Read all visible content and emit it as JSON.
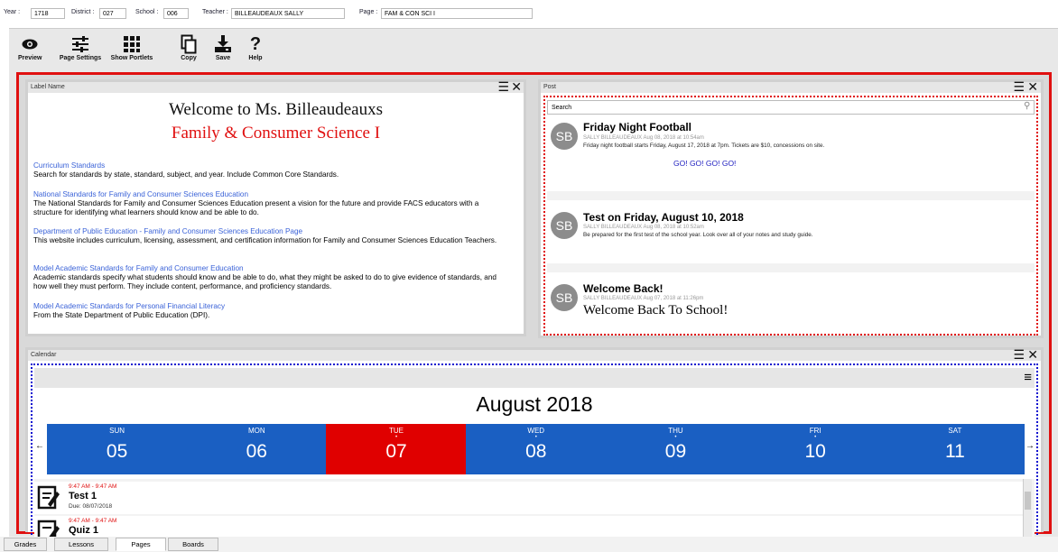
{
  "header": {
    "year_label": "Year :",
    "year_value": "1718",
    "district_label": "District :",
    "district_value": "027",
    "school_label": "School :",
    "school_value": "006",
    "teacher_label": "Teacher :",
    "teacher_value": "BILLEAUDEAUX SALLY",
    "page_label": "Page :",
    "page_value": "FAM & CON SCI I"
  },
  "toolbar": {
    "preview": "Preview",
    "page_settings": "Page Settings",
    "show_portlets": "Show Portlets",
    "copy": "Copy",
    "save": "Save",
    "help": "Help",
    "help_glyph": "?"
  },
  "label_portlet": {
    "title": "Label Name",
    "welcome_line1": "Welcome to Ms. Billeaudeauxs",
    "welcome_line2": "Family & Consumer Science I",
    "links": [
      {
        "title": "Curriculum Standards",
        "desc": "Search for standards by state, standard, subject, and year.  Include Common Core Standards."
      },
      {
        "title": "National Standards for Family and Consumer Sciences Education",
        "desc": "The National Standards for Family and Consumer  Sciences Education present a vision for the future and provide FACS educators with a structure for identifying what learners should know and be able to do."
      },
      {
        "title": "Department of Public Education - Family and Consumer Sciences Education Page",
        "desc": "This website includes curriculum, licensing, assessment, and certification information for Family and Consumer Sciences Education Teachers."
      },
      {
        "title": "Model Academic Standards for Family and Consumer Education",
        "desc": "Academic standards specify what students should know and be able to do, what they might be asked to do to give evidence of standards, and how well they must perform.  They include content, performance, and proficiency standards."
      },
      {
        "title": "Model Academic Standards for Personal Financial Literacy",
        "desc": "From the State Department of Public Education (DPI)."
      }
    ]
  },
  "post_portlet": {
    "title": "Post",
    "search_placeholder": "Search",
    "posts": [
      {
        "initials": "SB",
        "title": "Friday Night Football",
        "meta": "SALLY BILLEAUDEAUX Aug 08, 2018 at 10:54am",
        "body": "Friday night football starts Friday, August 17, 2018 at 7pm. Tickets are $10, concessions on site.",
        "extra": "GO! GO! GO! GO!"
      },
      {
        "initials": "SB",
        "title": "Test on Friday, August 10, 2018",
        "meta": "SALLY BILLEAUDEAUX Aug 08, 2018 at 10:52am",
        "body": "Be prepared for the first test of the school year. Look over all of your notes and study guide.",
        "extra": ""
      },
      {
        "initials": "SB",
        "title": "Welcome Back!",
        "meta": "SALLY BILLEAUDEAUX Aug 07, 2018 at 11:26pm",
        "body": "",
        "extra": "Welcome Back To School!"
      }
    ]
  },
  "calendar_portlet": {
    "title": "Calendar",
    "month_title": "August 2018",
    "prev": "←",
    "next": "→",
    "days": [
      {
        "name": "SUN",
        "date": "05",
        "dot": "",
        "selected": false
      },
      {
        "name": "MON",
        "date": "06",
        "dot": "",
        "selected": false
      },
      {
        "name": "TUE",
        "date": "07",
        "dot": "•",
        "selected": true
      },
      {
        "name": "WED",
        "date": "08",
        "dot": "•",
        "selected": false
      },
      {
        "name": "THU",
        "date": "09",
        "dot": "•",
        "selected": false
      },
      {
        "name": "FRI",
        "date": "10",
        "dot": "•",
        "selected": false
      },
      {
        "name": "SAT",
        "date": "11",
        "dot": "",
        "selected": false
      }
    ],
    "events": [
      {
        "time": "9:47 AM - 9:47 AM",
        "name": "Test 1",
        "due": "Due: 08/07/2018"
      },
      {
        "time": "9:47 AM - 9:47 AM",
        "name": "Quiz 1",
        "due": ""
      }
    ],
    "colors": {
      "day_blue": "#1a5fc2",
      "day_selected": "#e00000",
      "event_time": "#e01010"
    }
  },
  "tabs": [
    "Grades",
    "Lessons",
    "Pages",
    "Boards"
  ],
  "active_tab": "Pages"
}
